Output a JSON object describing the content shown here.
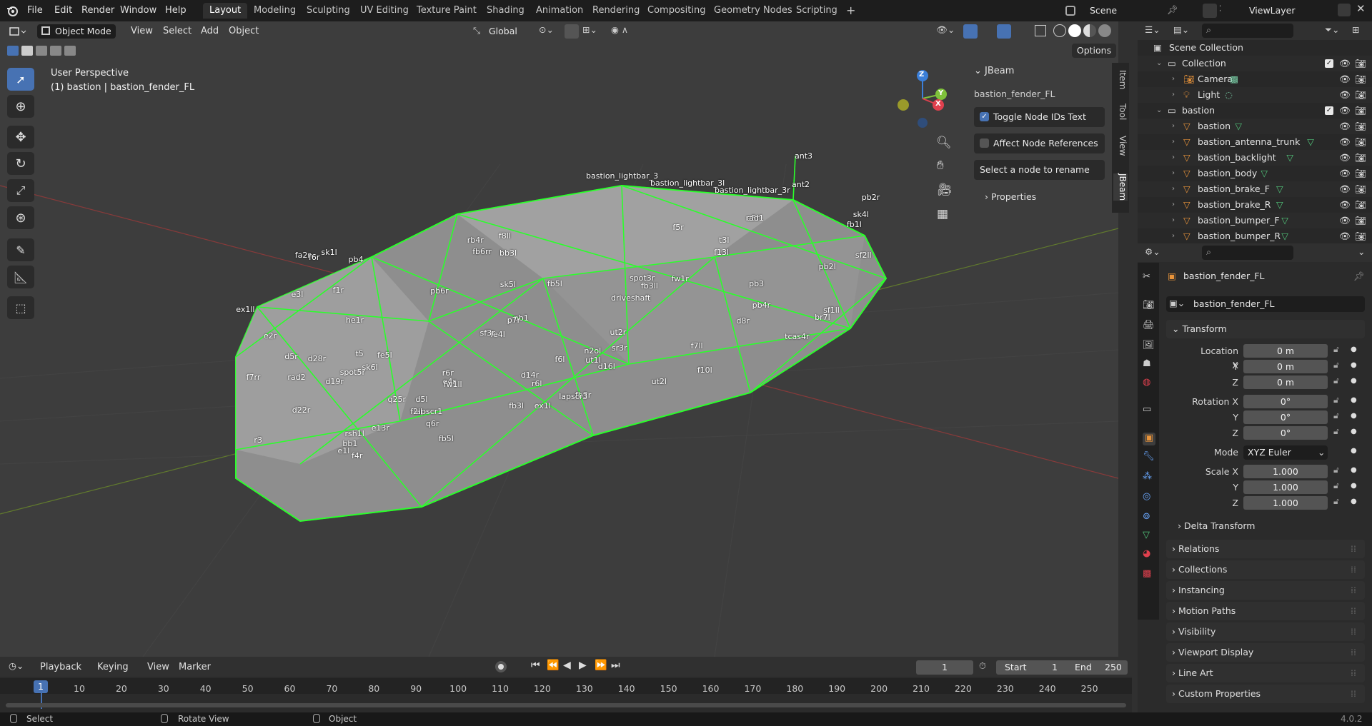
{
  "menu": [
    "File",
    "Edit",
    "Render",
    "Window",
    "Help"
  ],
  "workspaces": [
    "Layout",
    "Modeling",
    "Sculpting",
    "UV Editing",
    "Texture Paint",
    "Shading",
    "Animation",
    "Rendering",
    "Compositing",
    "Geometry Nodes",
    "Scripting"
  ],
  "active_workspace": "Layout",
  "scene_name": "Scene",
  "view_layer": "ViewLayer",
  "viewport_header": {
    "mode": "Object Mode",
    "menus": [
      "View",
      "Select",
      "Add",
      "Object"
    ],
    "transform_orientation": "Global",
    "options_label": "Options"
  },
  "viewport": {
    "view_name": "User Perspective",
    "object_info": "(1) bastion | bastion_fender_FL",
    "gizmo_axes": {
      "x": "X",
      "y": "Y",
      "z": "Z"
    },
    "node_labels": [
      "ant3",
      "ant2",
      "bastion_lightbar_3r",
      "bastion_lightbar_3",
      "bastion_lightbar_3l",
      "spot3r",
      "spot5r",
      "e4r",
      "fb3r",
      "fb1l",
      "pb4r",
      "pb4",
      "pb2r",
      "pb3",
      "pb1",
      "pb2l",
      "fb3l",
      "fb3ll",
      "fb5l",
      "f13l",
      "ut1l",
      "ut2l",
      "bb3l",
      "sk1l",
      "fw1ll",
      "fb5l",
      "ex1ll",
      "e1l",
      "sk5l",
      "sf2ll",
      "f7ll",
      "d5l",
      "f8ll",
      "sk6l",
      "d16l",
      "sk4l",
      "br7l",
      "r6l",
      "t3l",
      "driveshaft",
      "sf1ll",
      "d14r",
      "e13r",
      "f5r",
      "d8r",
      "lapscr1",
      "lapscr3",
      "d19r",
      "d28r",
      "q6r",
      "f6r",
      "e5r",
      "n2ol",
      "fe4l",
      "tcas4r",
      "ex1l",
      "fe5l",
      "pb6r",
      "he1r",
      "bb1",
      "rad2",
      "rad1",
      "f7rr",
      "e3l",
      "d5r",
      "sr3r",
      "q25r",
      "sf3r",
      "r6r",
      "rb4r",
      "f6l",
      "rsh1l",
      "r3",
      "t5",
      "ut2r",
      "f1r",
      "fw1r",
      "f4r",
      "e2r",
      "f10l",
      "p7r",
      "d22r",
      "f2ll",
      "fa2r",
      "fb6rr"
    ]
  },
  "npanel": {
    "tabs": [
      "Item",
      "Tool",
      "View",
      "JBeam"
    ],
    "panel_title": "JBeam",
    "object_name": "bastion_fender_FL",
    "toggle_node_ids": "Toggle Node IDs Text",
    "toggle_node_ids_checked": true,
    "affect_node_refs": "Affect Node References",
    "affect_node_refs_checked": false,
    "rename_hint": "Select a node to rename",
    "properties_label": "Properties"
  },
  "outliner": {
    "root": "Scene Collection",
    "rows": [
      {
        "label": "Collection",
        "indent": 1,
        "type": "collection"
      },
      {
        "label": "Camera",
        "indent": 2,
        "type": "camera"
      },
      {
        "label": "Light",
        "indent": 2,
        "type": "light"
      },
      {
        "label": "bastion",
        "indent": 1,
        "type": "collection"
      },
      {
        "label": "bastion",
        "indent": 2,
        "type": "mesh"
      },
      {
        "label": "bastion_antenna_trunk",
        "indent": 2,
        "type": "mesh"
      },
      {
        "label": "bastion_backlight",
        "indent": 2,
        "type": "mesh"
      },
      {
        "label": "bastion_body",
        "indent": 2,
        "type": "mesh"
      },
      {
        "label": "bastion_brake_F",
        "indent": 2,
        "type": "mesh"
      },
      {
        "label": "bastion_brake_R",
        "indent": 2,
        "type": "mesh"
      },
      {
        "label": "bastion_bumper_F",
        "indent": 2,
        "type": "mesh"
      },
      {
        "label": "bastion_bumper_R",
        "indent": 2,
        "type": "mesh"
      }
    ]
  },
  "properties": {
    "object_name": "bastion_fender_FL",
    "datablock_name": "bastion_fender_FL",
    "transform_label": "Transform",
    "location_label": "Location X",
    "rotation_label": "Rotation X",
    "scale_label": "Scale X",
    "y_label": "Y",
    "z_label": "Z",
    "location": [
      "0 m",
      "0 m",
      "0 m"
    ],
    "rotation": [
      "0°",
      "0°",
      "0°"
    ],
    "mode_label": "Mode",
    "mode_value": "XYZ Euler",
    "scale": [
      "1.000",
      "1.000",
      "1.000"
    ],
    "delta_transform": "Delta Transform",
    "panels": [
      "Relations",
      "Collections",
      "Instancing",
      "Motion Paths",
      "Visibility",
      "Viewport Display",
      "Line Art",
      "Custom Properties"
    ]
  },
  "timeline": {
    "menus": [
      "Playback",
      "Keying",
      "View",
      "Marker"
    ],
    "current_frame": "1",
    "start_label": "Start",
    "start_value": "1",
    "end_label": "End",
    "end_value": "250",
    "ruler": [
      "10",
      "20",
      "30",
      "40",
      "50",
      "60",
      "70",
      "80",
      "90",
      "100",
      "110",
      "120",
      "130",
      "140",
      "150",
      "160",
      "170",
      "180",
      "190",
      "200",
      "210",
      "220",
      "230",
      "240",
      "250"
    ],
    "playhead_label": "1"
  },
  "statusbar": {
    "select": "Select",
    "rotate": "Rotate View",
    "object": "Object",
    "version": "4.0.2"
  },
  "colors": {
    "accent": "#4772b3",
    "wire": "#2bff2b",
    "mesh_icon": "#e8933a",
    "collection_icon": "#e8e8e8",
    "mesh_data_icon": "#52c77b"
  }
}
